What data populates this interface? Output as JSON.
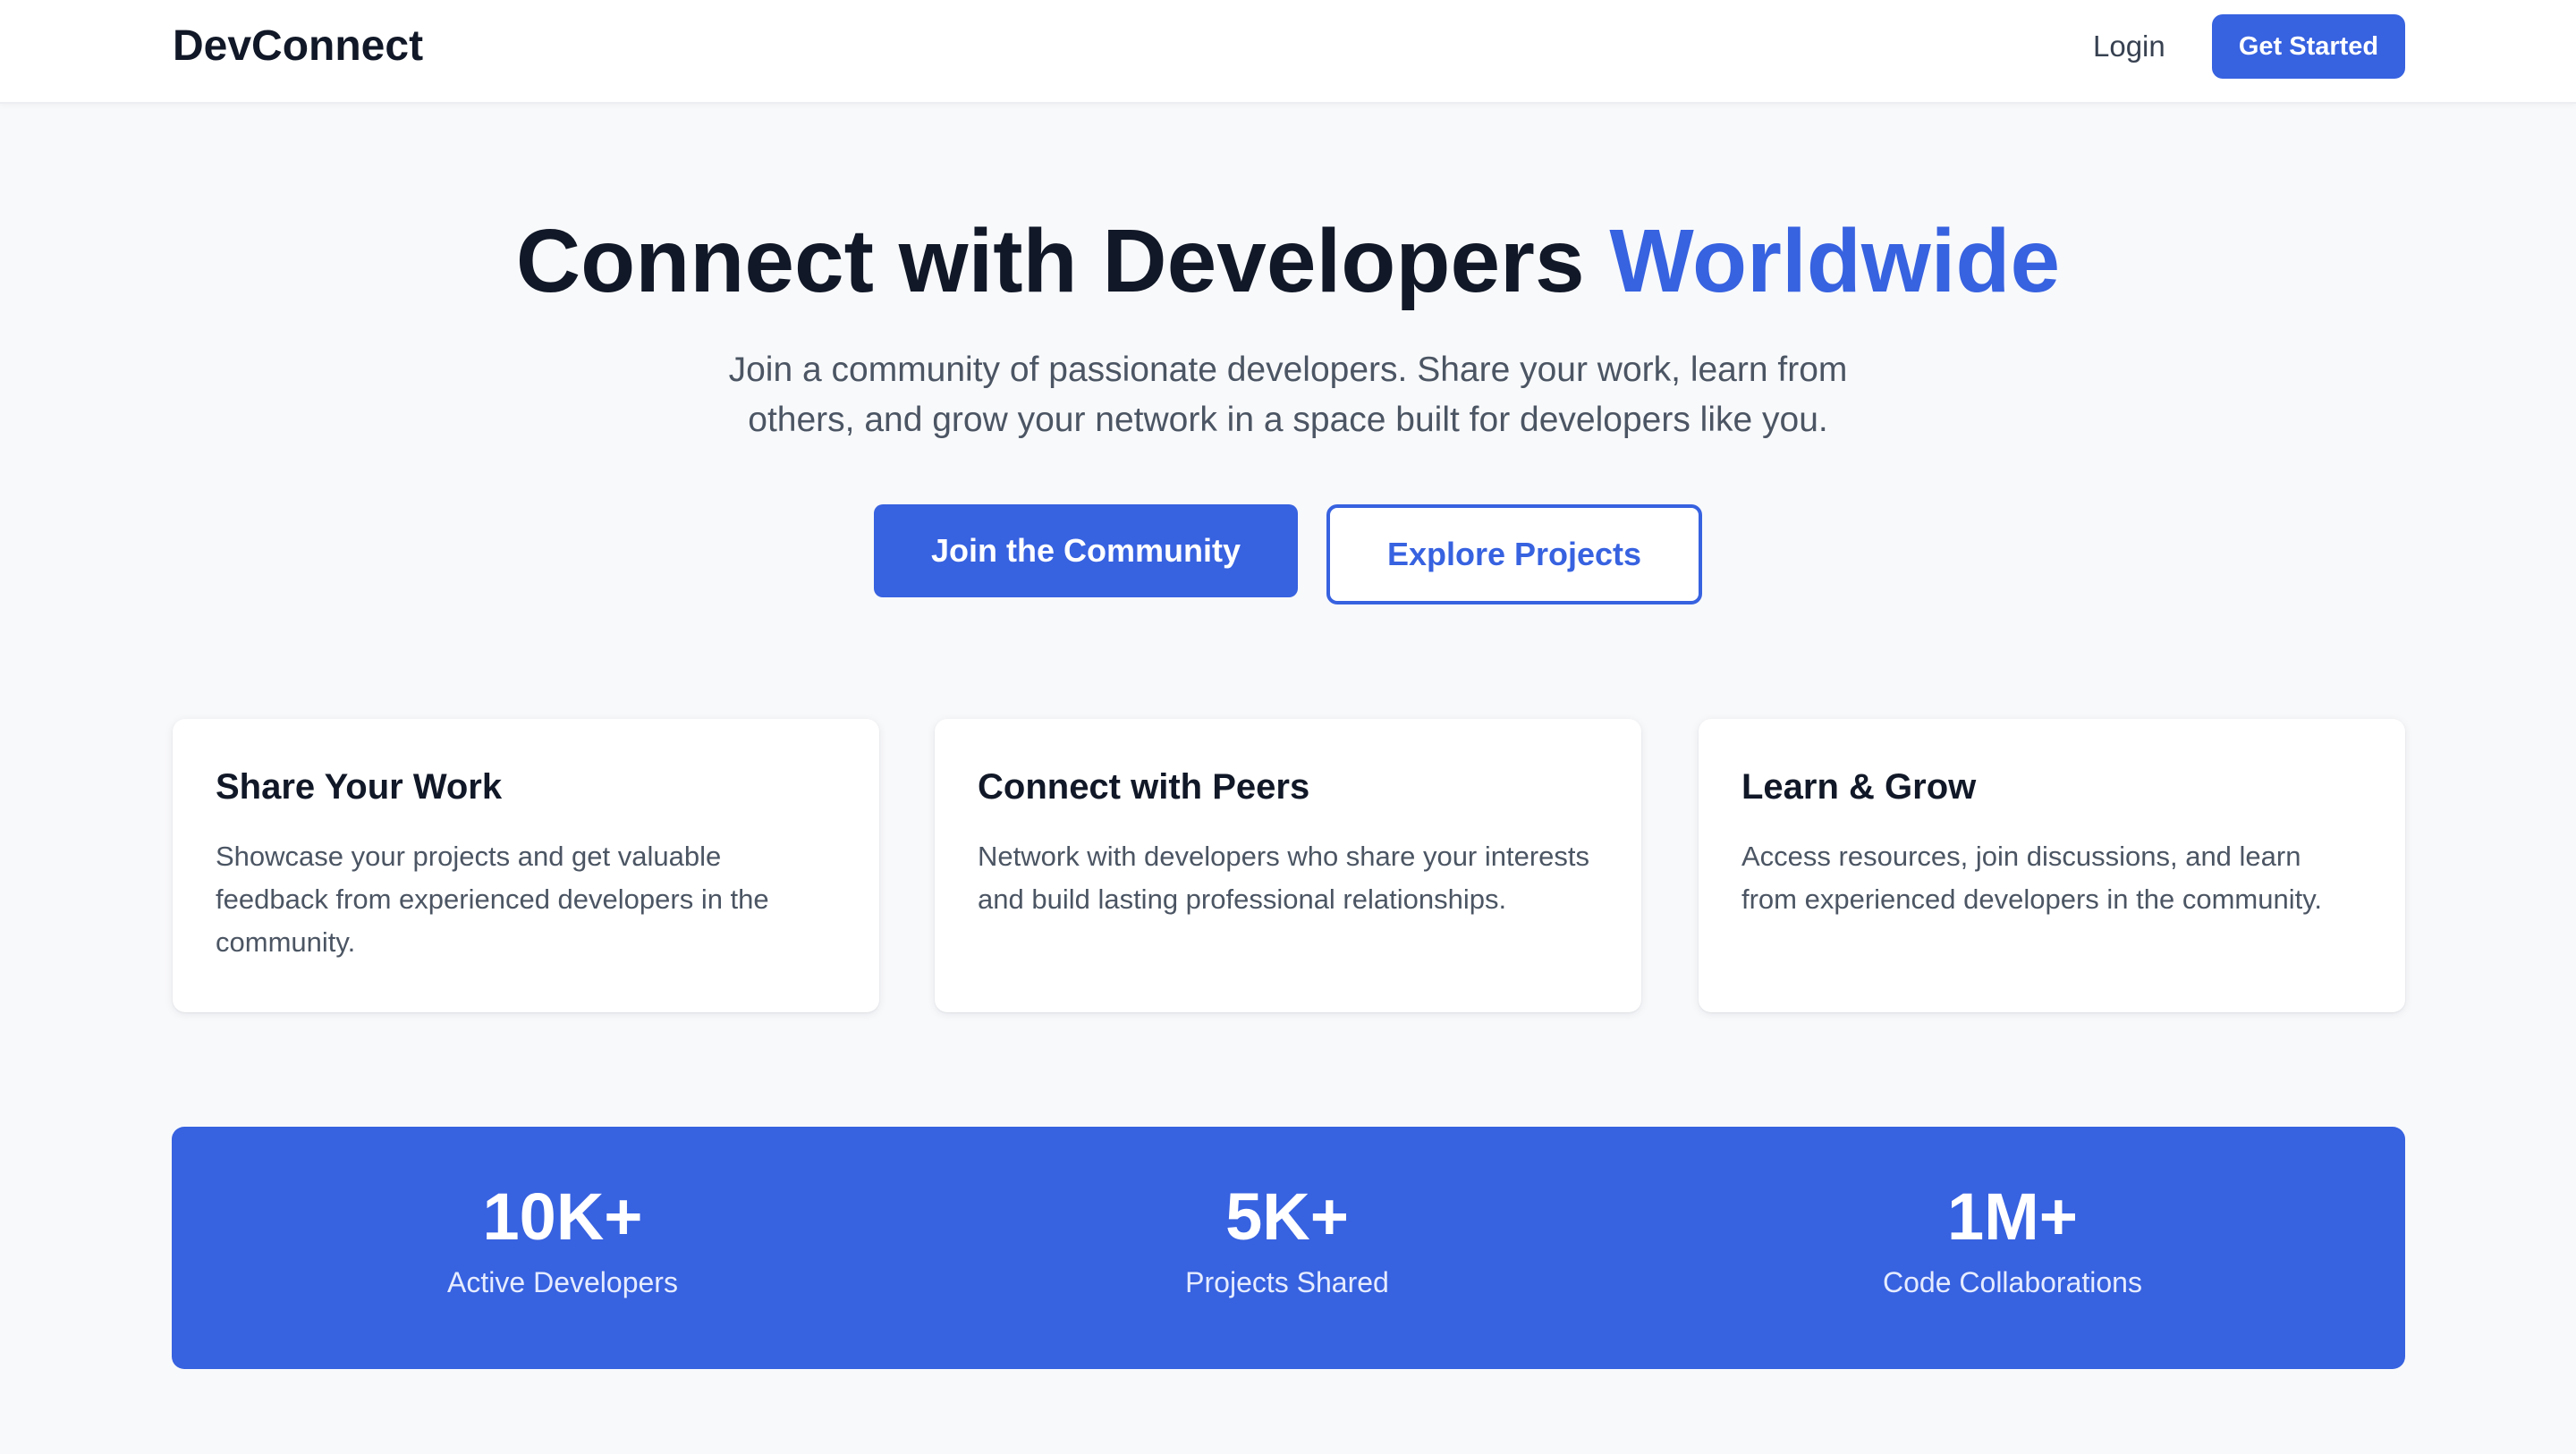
{
  "nav": {
    "brand": "DevConnect",
    "login": "Login",
    "get_started": "Get Started"
  },
  "hero": {
    "title_main": "Connect with Developers ",
    "title_accent": "Worldwide",
    "subtitle_line1": "Join a community of passionate developers. Share your work, learn from",
    "subtitle_line2": "others, and grow your network in a space built for developers like you.",
    "primary_button": "Join the Community",
    "secondary_button": "Explore Projects"
  },
  "features": [
    {
      "title": "Share Your Work",
      "text": "Showcase your projects and get valuable feedback from experienced developers in the community."
    },
    {
      "title": "Connect with Peers",
      "text": "Network with developers who share your interests and build lasting professional relationships."
    },
    {
      "title": "Learn & Grow",
      "text": "Access resources, join discussions, and learn from experienced developers in the community."
    }
  ],
  "stats": [
    {
      "value": "10K+",
      "label": "Active Developers"
    },
    {
      "value": "5K+",
      "label": "Projects Shared"
    },
    {
      "value": "1M+",
      "label": "Code Collaborations"
    }
  ],
  "colors": {
    "accent": "#3762e0",
    "background": "#f8f9fb",
    "text": "#111827",
    "muted": "#4b5563"
  }
}
